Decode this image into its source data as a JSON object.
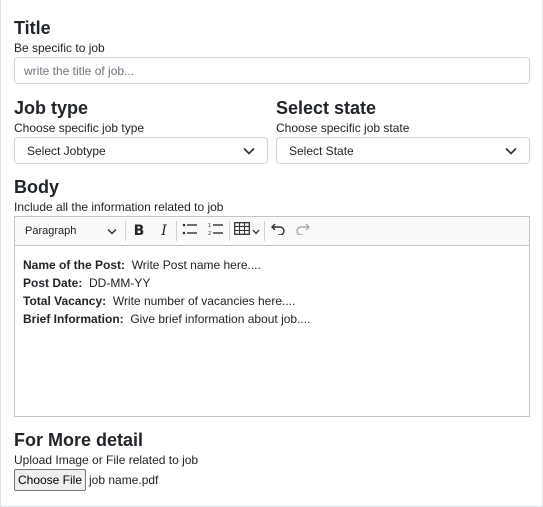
{
  "title_section": {
    "heading": "Title",
    "hint": "Be specific to job",
    "placeholder": "write the title of job..."
  },
  "job_type": {
    "heading": "Job type",
    "hint": "Choose specific job type",
    "selected": "Select Jobtype"
  },
  "state": {
    "heading": "Select state",
    "hint": "Choose specific job state",
    "selected": "Select State"
  },
  "body_section": {
    "heading": "Body",
    "hint": "Include all the information related to job",
    "toolbar": {
      "paragraph_label": "Paragraph",
      "icons": [
        "bold-icon",
        "italic-icon",
        "bulleted-list-icon",
        "numbered-list-icon",
        "table-icon",
        "undo-icon",
        "redo-icon"
      ]
    },
    "content": [
      {
        "label": "Name of the Post:",
        "value": "Write Post name here...."
      },
      {
        "label": "Post Date:",
        "value": "DD-MM-YY"
      },
      {
        "label": "Total Vacancy:",
        "value": "Write number of vacancies here...."
      },
      {
        "label": "Brief Information:",
        "value": "Give brief information about job...."
      }
    ]
  },
  "upload": {
    "heading": "For More detail",
    "hint": "Upload Image or File related to job",
    "button_label": "Choose File",
    "file_name": "job name.pdf"
  }
}
